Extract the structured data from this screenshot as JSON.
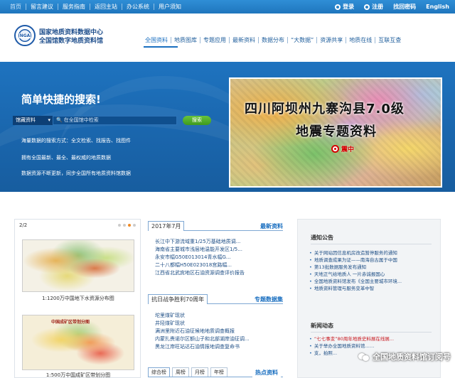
{
  "topbar": {
    "links": [
      "首页",
      "留言建议",
      "服务指南",
      "返回主站",
      "办公系统",
      "用户须知"
    ],
    "login": "登录",
    "register": "注册",
    "forgot": "找回密码",
    "english": "English"
  },
  "header": {
    "logo_text": "NGA",
    "title_line1": "国家地质资料数据中心",
    "title_line2": "全国馆数字地质资料馆",
    "nav": [
      "全国资料",
      "地质图库",
      "专题应用",
      "最新资料",
      "数据分布",
      "“大数据”",
      "资源共享",
      "地质在线",
      "互联互查"
    ]
  },
  "banner": {
    "title": "简单快捷的搜索!",
    "search_select": "馆藏资料",
    "search_placeholder": "在全国馆中检索",
    "search_button": "搜索",
    "features": [
      "海量数据的搜索方式：全文检索、找报告、找图件",
      "拥有全国最新、最全、最权威的地质数据",
      "数据资源不断更新，同步全国所有地质资料馆数据"
    ],
    "promo_line1": "四川阿坝州九寨沟县7.0级",
    "promo_line2": "地震专题资料",
    "promo_mark": "震中"
  },
  "gallery": {
    "count": "2/2",
    "map1_caption": "1:1200万中国地下水资源分布图",
    "map2_heading": "中国成矿区带划分图",
    "map2_caption": "1:500万中国成矿区带划分图"
  },
  "latest": {
    "tab": "2017年7月",
    "more": "最新资料",
    "items": [
      "长江中下游流域重1/25万基础地质调...",
      "海南省主要城市浅层地温能开发区1/5...",
      "永安市幅G50E013014青水幅G...",
      "二十八都幅H50E023018宫路幅...",
      "江西省北武宾地区石油资源调查评价报告"
    ]
  },
  "special": {
    "tab": "抗日战争胜利70周年",
    "more": "专题数据集",
    "items": [
      "坨里煤矿现状",
      "井陉煤矿现状",
      "满洲里附近石油征候地地质调查概报",
      "内蒙扎赉诺尔区额山子和北部湖岸油征调...",
      "黑龙江岸旺站达石油情报地调查复命书"
    ]
  },
  "ranking": {
    "tabs": [
      "综合榜",
      "周榜",
      "月榜",
      "年榜"
    ],
    "more": "热点资料"
  },
  "notices": {
    "title": "通知公告",
    "items": [
      "关于网站因信息机房改造暂停服务的通知",
      "地质调查成果为证——南海自古属于中国",
      "第13批数据服务发布通知",
      "天地正气给地质人 一片赤诚报国心",
      "全国地质资料馆发布《全国主要城市环境...",
      "地质资料管理与服务变革中智"
    ]
  },
  "news": {
    "title": "新闻动态",
    "items": [
      "“七七事变”80周年地质史料展在线展...",
      "关于举办全国地质资料馆……",
      "支，拍照..."
    ]
  },
  "watermark": "全国地质资料馆订阅号"
}
